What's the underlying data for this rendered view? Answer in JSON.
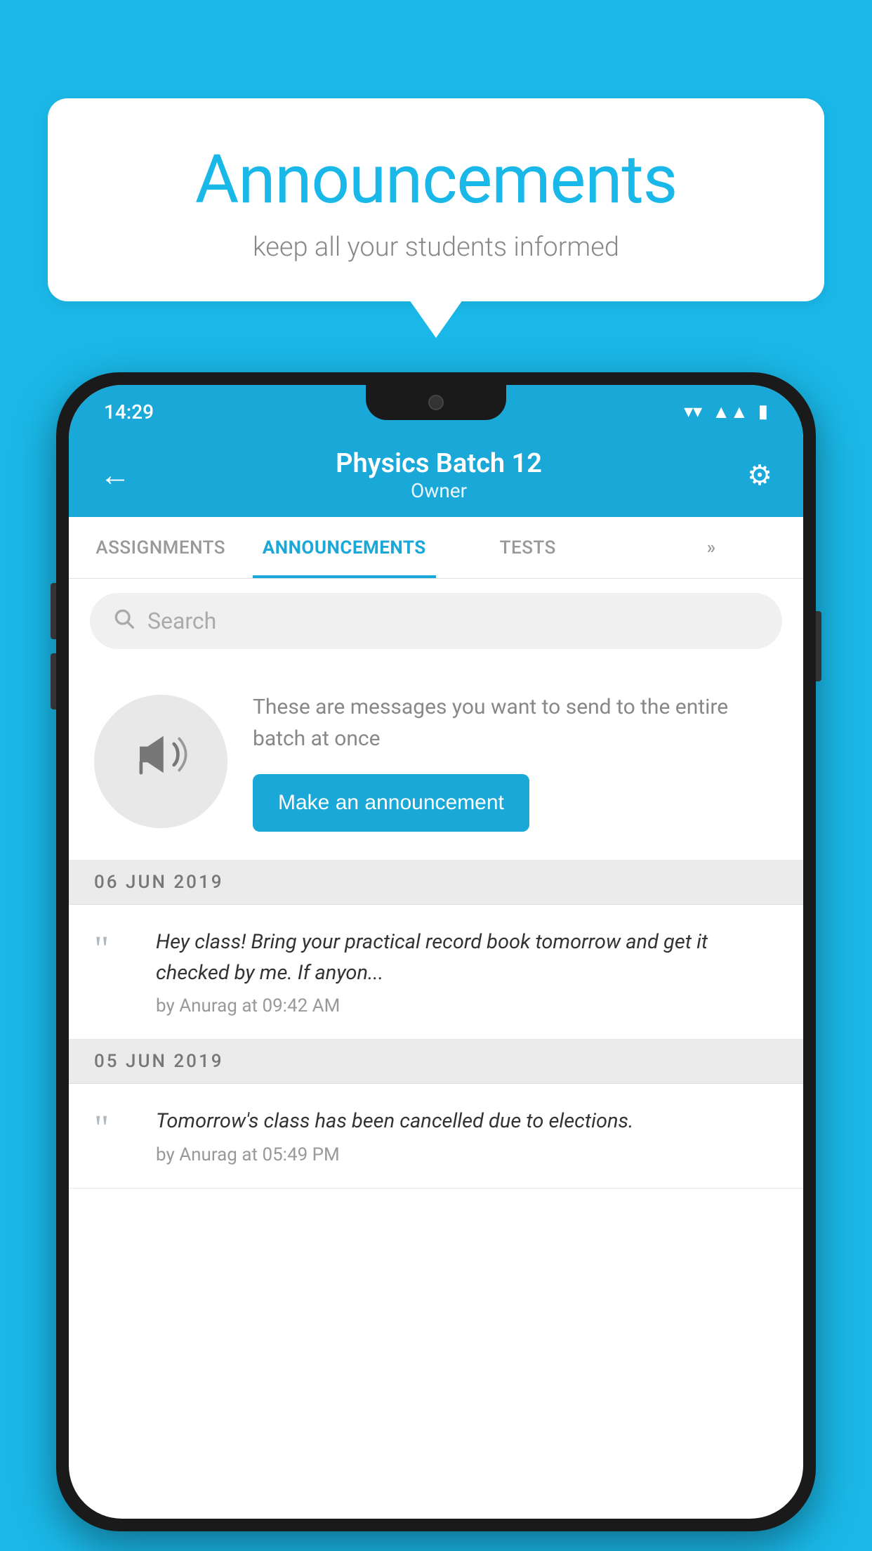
{
  "background_color": "#1ab8e8",
  "speech_bubble": {
    "title": "Announcements",
    "subtitle": "keep all your students informed"
  },
  "phone": {
    "status_bar": {
      "time": "14:29",
      "wifi": "▼",
      "signal": "▲",
      "battery": "▮"
    },
    "app_bar": {
      "back_label": "←",
      "title": "Physics Batch 12",
      "subtitle": "Owner",
      "settings_label": "⚙"
    },
    "tabs": [
      {
        "label": "ASSIGNMENTS",
        "active": false
      },
      {
        "label": "ANNOUNCEMENTS",
        "active": true
      },
      {
        "label": "TESTS",
        "active": false
      },
      {
        "label": "»",
        "active": false
      }
    ],
    "search": {
      "placeholder": "Search"
    },
    "announce_prompt": {
      "description": "These are messages you want to send to the entire batch at once",
      "button_label": "Make an announcement"
    },
    "announcement_groups": [
      {
        "date": "06  JUN  2019",
        "items": [
          {
            "message": "Hey class! Bring your practical record book tomorrow and get it checked by me. If anyon...",
            "meta": "by Anurag at 09:42 AM"
          }
        ]
      },
      {
        "date": "05  JUN  2019",
        "items": [
          {
            "message": "Tomorrow's class has been cancelled due to elections.",
            "meta": "by Anurag at 05:49 PM"
          }
        ]
      }
    ]
  }
}
